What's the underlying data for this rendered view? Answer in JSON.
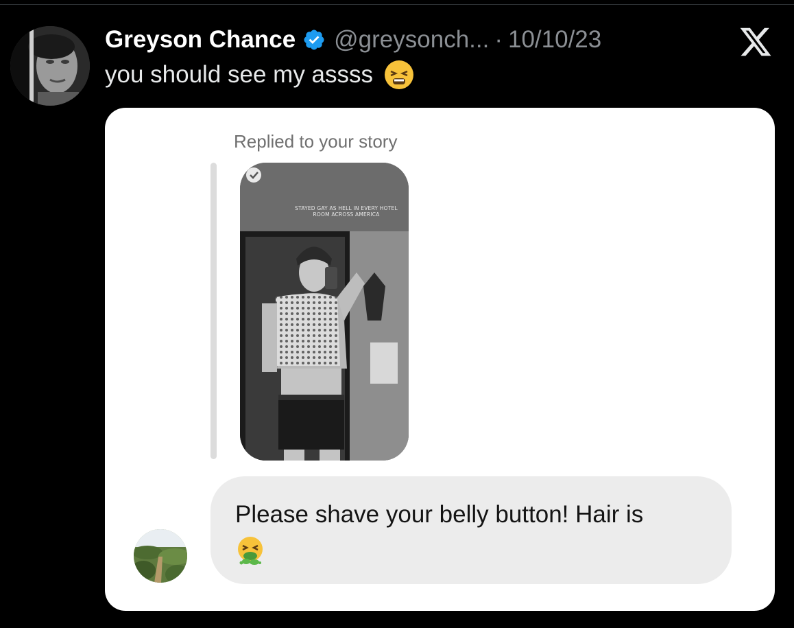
{
  "tweet": {
    "author_name": "Greyson Chance",
    "handle": "@greysonch...",
    "separator": "·",
    "date": "10/10/23",
    "text": "you should see my assss",
    "text_emoji": "tired-face-emoji"
  },
  "platform_logo": "x-logo-icon",
  "dm_card": {
    "replied_label": "Replied to your story",
    "story_caption": "STAYED GAY AS HELL IN EVERY HOTEL ROOM ACROSS AMERICA",
    "message_text": "Please shave your belly button! Hair is",
    "message_emoji": "vomiting-face-emoji"
  },
  "colors": {
    "background": "#000000",
    "verified_blue": "#1d9bf0",
    "muted_text": "#8b8f94",
    "bubble_bg": "#ececec"
  }
}
